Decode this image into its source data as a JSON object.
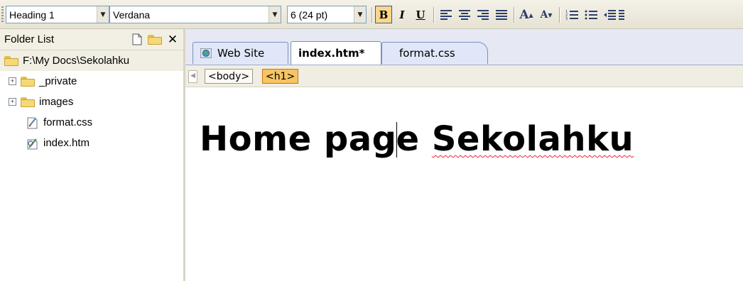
{
  "toolbar": {
    "style_value": "Heading 1",
    "font_value": "Verdana",
    "size_value": "6  (24 pt)",
    "bold_label": "B",
    "italic_label": "I",
    "underline_label": "U"
  },
  "folder_list": {
    "title": "Folder List",
    "root": "F:\\My Docs\\Sekolahku",
    "items": [
      {
        "label": "_private",
        "type": "folder"
      },
      {
        "label": "images",
        "type": "folder"
      },
      {
        "label": "format.css",
        "type": "file"
      },
      {
        "label": "index.htm",
        "type": "file"
      }
    ]
  },
  "tabs": [
    {
      "label": "Web Site"
    },
    {
      "label": "index.htm*"
    },
    {
      "label": "format.css"
    }
  ],
  "breadcrumb": [
    "<body>",
    "<h1>"
  ],
  "document": {
    "heading_part1": "Home pag",
    "heading_part2": "e ",
    "heading_part3": "Sekolahku"
  },
  "colors": {
    "selected_button": "#f8d68b",
    "tab_border": "#7b8fba",
    "spelling_underline": "#e23"
  }
}
